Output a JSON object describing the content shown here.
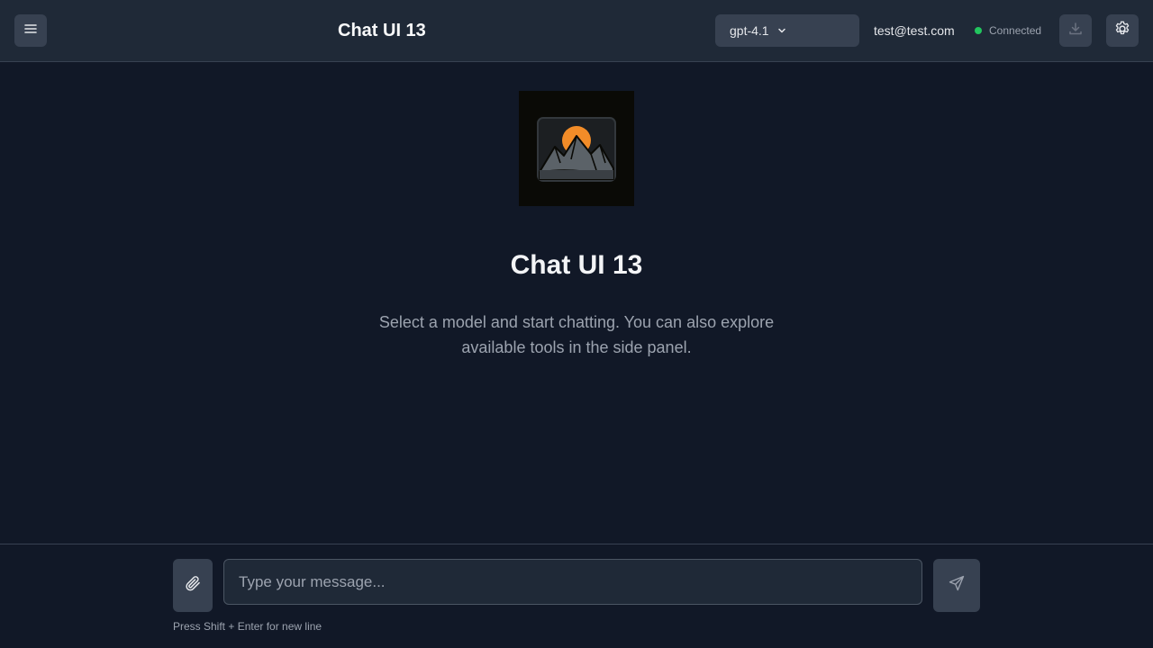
{
  "header": {
    "title": "Chat UI 13",
    "model": "gpt-4.1",
    "user_email": "test@test.com",
    "status": "Connected",
    "status_color": "#22c55e"
  },
  "hero": {
    "title": "Chat UI 13",
    "subtitle": "Select a model and start chatting. You can also explore available tools in the side panel."
  },
  "composer": {
    "placeholder": "Type your message...",
    "hint": "Press Shift + Enter for new line"
  },
  "icons": {
    "menu": "hamburger-icon",
    "model_chevron": "chevron-down-icon",
    "download": "download-icon",
    "settings": "gear-icon",
    "attach": "paperclip-icon",
    "send": "send-icon"
  },
  "colors": {
    "background": "#111827",
    "panel": "#1f2937",
    "button": "#374151",
    "logo_sun": "#f28c28"
  }
}
